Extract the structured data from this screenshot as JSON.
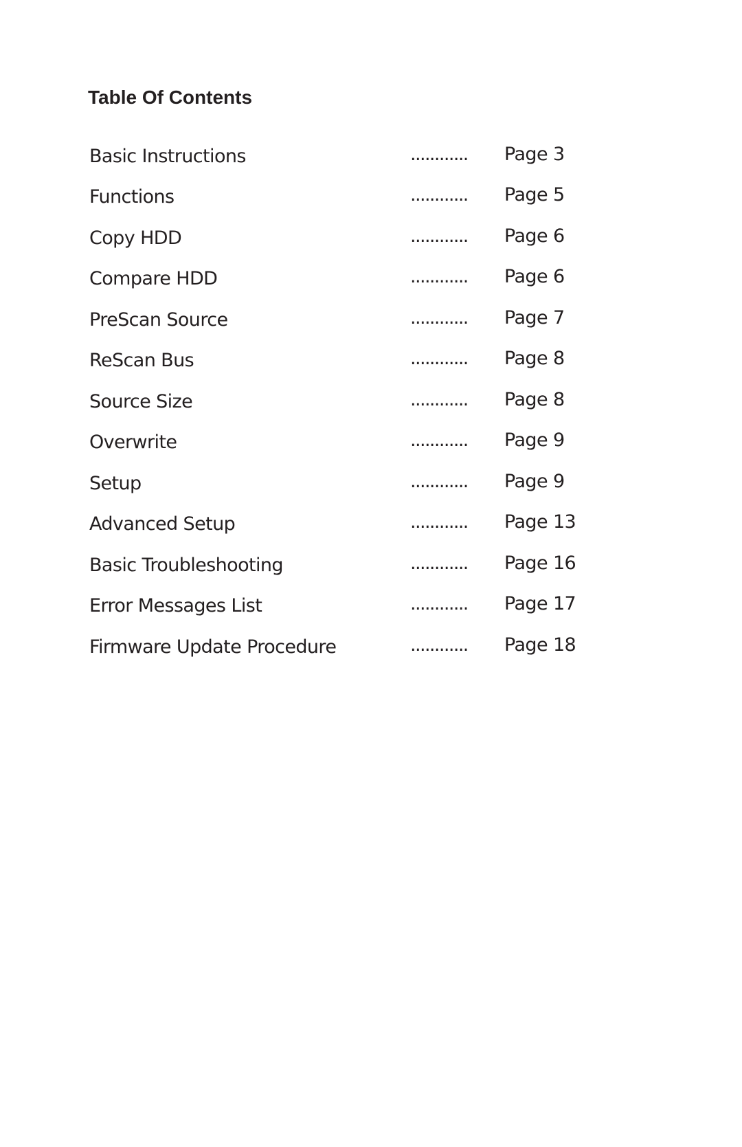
{
  "document": {
    "title": "Table Of Contents",
    "leader": "............",
    "entries": [
      {
        "label": "Basic Instructions",
        "page": "Page 3"
      },
      {
        "label": "Functions",
        "page": "Page 5"
      },
      {
        "label": "Copy HDD",
        "page": "Page 6"
      },
      {
        "label": "Compare HDD",
        "page": "Page 6"
      },
      {
        "label": "PreScan Source",
        "page": "Page 7"
      },
      {
        "label": "ReScan Bus",
        "page": "Page 8"
      },
      {
        "label": "Source Size",
        "page": "Page 8"
      },
      {
        "label": "Overwrite",
        "page": "Page 9"
      },
      {
        "label": "Setup",
        "page": "Page 9"
      },
      {
        "label": "Advanced Setup",
        "page": "Page 13"
      },
      {
        "label": "Basic Troubleshooting",
        "page": "Page 16"
      },
      {
        "label": "Error Messages List",
        "page": "Page 17"
      },
      {
        "label": "Firmware Update Procedure",
        "page": "Page 18"
      }
    ]
  }
}
